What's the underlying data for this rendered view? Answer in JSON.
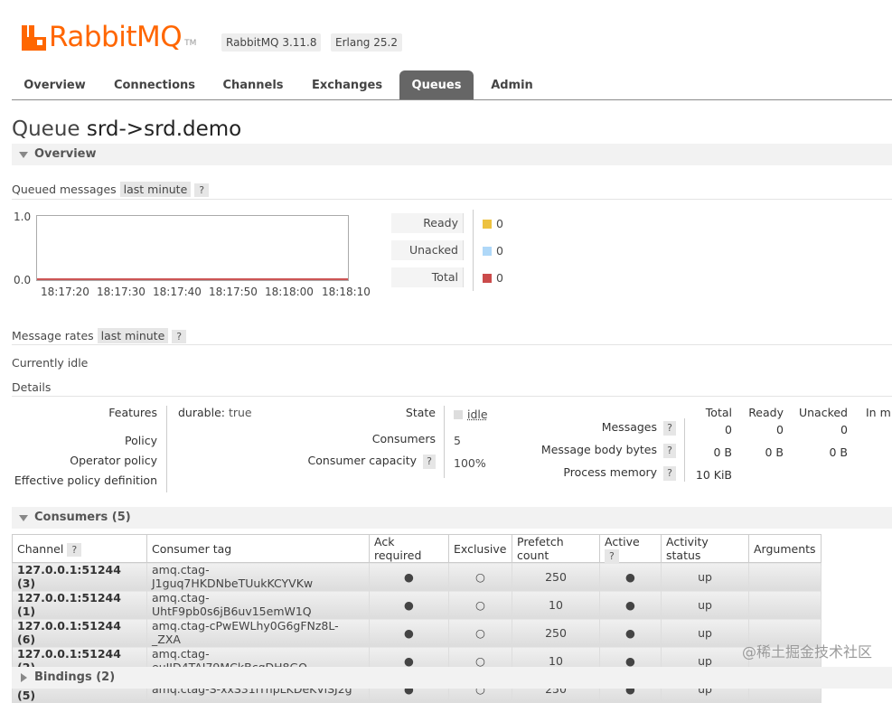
{
  "header": {
    "logo_text": "RabbitMQ",
    "logo_tm": "TM",
    "rabbitmq_version": "RabbitMQ 3.11.8",
    "erlang_version": "Erlang 25.2"
  },
  "nav": {
    "tabs": [
      {
        "label": "Overview"
      },
      {
        "label": "Connections"
      },
      {
        "label": "Channels"
      },
      {
        "label": "Exchanges"
      },
      {
        "label": "Queues"
      },
      {
        "label": "Admin"
      }
    ],
    "active": "Queues"
  },
  "page": {
    "title_prefix": "Queue",
    "title_name": "srd->srd.demo"
  },
  "overview": {
    "section_label": "Overview",
    "queued_label": "Queued messages",
    "queued_period": "last minute",
    "help": "?",
    "chart": {
      "y_max": "1.0",
      "y_min": "0.0",
      "x_ticks": [
        "18:17:20",
        "18:17:30",
        "18:17:40",
        "18:17:50",
        "18:18:00",
        "18:18:10"
      ]
    },
    "legend": [
      {
        "label": "Ready",
        "value": "0",
        "color": "#edc240"
      },
      {
        "label": "Unacked",
        "value": "0",
        "color": "#afd8f8"
      },
      {
        "label": "Total",
        "value": "0",
        "color": "#cb4b4b"
      }
    ],
    "rates_label": "Message rates",
    "rates_period": "last minute",
    "idle_text": "Currently idle",
    "details_label": "Details"
  },
  "details": {
    "features_label": "Features",
    "features_key": "durable:",
    "features_value": "true",
    "policy_label": "Policy",
    "operator_policy_label": "Operator policy",
    "effective_policy_label": "Effective policy definition",
    "state_label": "State",
    "state_value": "idle",
    "consumers_label": "Consumers",
    "consumers_value": "5",
    "capacity_label": "Consumer capacity",
    "capacity_value": "100%",
    "stats_headers": [
      "Total",
      "Ready",
      "Unacked",
      "In m"
    ],
    "messages_label": "Messages",
    "messages_values": [
      "0",
      "0",
      "0"
    ],
    "body_bytes_label": "Message body bytes",
    "body_bytes_values": [
      "0 B",
      "0 B",
      "0 B"
    ],
    "process_memory_label": "Process memory",
    "process_memory_value": "10 KiB"
  },
  "consumers": {
    "section_label": "Consumers (5)",
    "headers": [
      "Channel",
      "Consumer tag",
      "Ack required",
      "Exclusive",
      "Prefetch count",
      "Active",
      "Activity status",
      "Arguments"
    ],
    "rows": [
      {
        "channel": "127.0.0.1:51244 (3)",
        "tag": "amq.ctag-J1guq7HKDNbeTUukKCYVKw",
        "ack": "●",
        "exclusive": "○",
        "prefetch": "250",
        "active": "●",
        "status": "up",
        "args": ""
      },
      {
        "channel": "127.0.0.1:51244 (1)",
        "tag": "amq.ctag-UhtF9pb0s6jB6uv15emW1Q",
        "ack": "●",
        "exclusive": "○",
        "prefetch": "10",
        "active": "●",
        "status": "up",
        "args": ""
      },
      {
        "channel": "127.0.0.1:51244 (6)",
        "tag": "amq.ctag-cPwEWLhy0G6gFNz8L-_ZXA",
        "ack": "●",
        "exclusive": "○",
        "prefetch": "250",
        "active": "●",
        "status": "up",
        "args": ""
      },
      {
        "channel": "127.0.0.1:51244 (2)",
        "tag": "amq.ctag-euJJD4TAJ79MCkBcgDH8GQ",
        "ack": "●",
        "exclusive": "○",
        "prefetch": "10",
        "active": "●",
        "status": "up",
        "args": ""
      },
      {
        "channel": "127.0.0.1:51244 (5)",
        "tag": "amq.ctag-S-xxS31iThpLKDeKViSJ2g",
        "ack": "●",
        "exclusive": "○",
        "prefetch": "250",
        "active": "●",
        "status": "up",
        "args": ""
      }
    ]
  },
  "bindings": {
    "section_label": "Bindings (2)"
  },
  "watermark": "@稀土掘金技术社区"
}
